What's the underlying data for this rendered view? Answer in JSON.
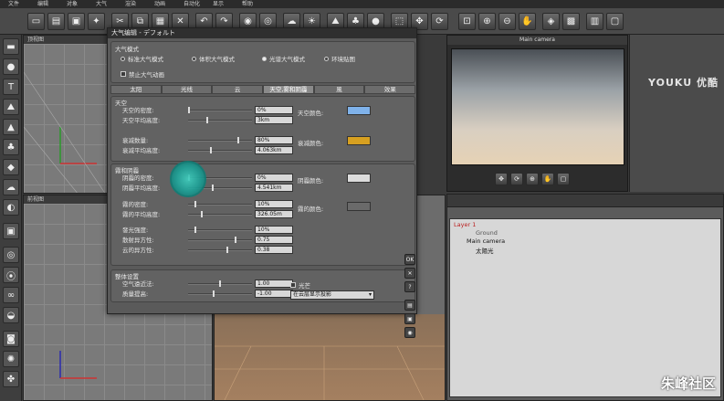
{
  "menubar": [
    "文件",
    "编辑",
    "对象",
    "大气",
    "渲染",
    "动画",
    "自动化",
    "显示",
    "帮助"
  ],
  "viewports": {
    "top_view": "顶视图",
    "front_view": "前视图"
  },
  "dialog": {
    "title": "大气编辑 - デフォルト",
    "mode_group": {
      "title": "大气模式",
      "options": [
        {
          "label": "标准大气模式",
          "selected": false
        },
        {
          "label": "体积大气模式",
          "selected": false
        },
        {
          "label": "光谱大气模式",
          "selected": true
        },
        {
          "label": "环境贴图",
          "selected": false
        }
      ],
      "disable_animation": "禁止大气动画"
    },
    "tabs": [
      {
        "label": "太阳",
        "active": false
      },
      {
        "label": "光线",
        "active": false
      },
      {
        "label": "云",
        "active": false
      },
      {
        "label": "天空,雾和阴霾",
        "active": true
      },
      {
        "label": "風",
        "active": false
      },
      {
        "label": "效果",
        "active": false
      }
    ],
    "sky": {
      "title": "天空",
      "rows": [
        {
          "label": "天空的密度:",
          "value": "0%",
          "pos": 0.0
        },
        {
          "label": "天空平均高度:",
          "value": "3km",
          "pos": 0.3
        },
        {
          "label": "衰减数量:",
          "value": "80%",
          "pos": 0.8
        },
        {
          "label": "衰减平均高度:",
          "value": "4.063km",
          "pos": 0.35
        }
      ],
      "sky_color_label": "天空颜色:",
      "sky_color": "#7fb2ea",
      "decay_color_label": "衰减颜色:",
      "decay_color": "#d7a020"
    },
    "haze": {
      "title": "霧和阴霾",
      "rows": [
        {
          "label": "阴霾的密度:",
          "value": "0%",
          "pos": 0.0
        },
        {
          "label": "阴霾平均高度:",
          "value": "4.541km",
          "pos": 0.38
        },
        {
          "label": "霧的密度:",
          "value": "10%",
          "pos": 0.1
        },
        {
          "label": "霧的平均高度:",
          "value": "326.05m",
          "pos": 0.2
        },
        {
          "label": "發光强度:",
          "value": "10%",
          "pos": 0.1
        },
        {
          "label": "散射异方性:",
          "value": "0.75",
          "pos": 0.75
        },
        {
          "label": "云的异方性:",
          "value": "0.38",
          "pos": 0.62
        }
      ],
      "haze_color_label": "阴霾颜色:",
      "haze_color": "#dcdcdc",
      "fog_color_label": "霧的颜色:",
      "fog_color": "#6a6a6a"
    },
    "global": {
      "title": "整体设置",
      "rows": [
        {
          "label": "空气遠近法:",
          "value": "1.00",
          "pos": 0.5
        },
        {
          "label": "质量提高:",
          "value": "-1.00",
          "pos": 0.4
        }
      ],
      "lightshaft_label": "光芒",
      "dropdown": "在云层显示投影"
    },
    "side_buttons": [
      "OK",
      "✕",
      "?"
    ]
  },
  "camera_panel": {
    "title": "Main camera"
  },
  "scene_tree": [
    {
      "label": "Layer 1",
      "indent": 0
    },
    {
      "label": "Ground",
      "indent": 2
    },
    {
      "label": "Main camera",
      "indent": 1
    },
    {
      "label": "太陽光",
      "indent": 2
    }
  ],
  "watermark": {
    "top": "YOUKU 优酷",
    "bottom": "朱峰社区"
  }
}
